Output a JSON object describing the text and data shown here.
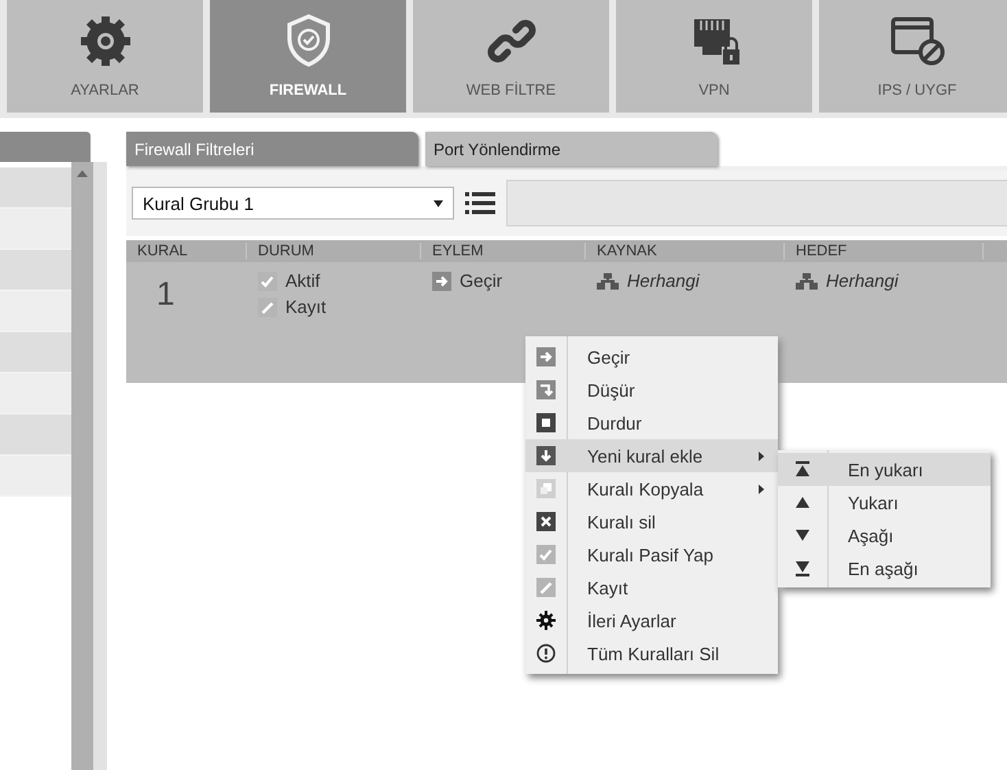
{
  "nav": [
    {
      "label": "AYARLAR",
      "kind": "gear",
      "selected": false
    },
    {
      "label": "FIREWALL",
      "kind": "shield",
      "selected": true
    },
    {
      "label": "WEB FİLTRE",
      "kind": "link",
      "selected": false
    },
    {
      "label": "VPN",
      "kind": "port",
      "selected": false
    },
    {
      "label": "IPS / UYGF",
      "kind": "window",
      "selected": false
    }
  ],
  "tabs": [
    {
      "label": "Firewall Filtreleri",
      "selected": true
    },
    {
      "label": "Port Yönlendirme",
      "selected": false
    }
  ],
  "rule_group": {
    "value": "Kural Grubu 1"
  },
  "table": {
    "columns": [
      "KURAL",
      "DURUM",
      "EYLEM",
      "KAYNAK",
      "HEDEF"
    ],
    "rows": [
      {
        "number": "1",
        "status": [
          {
            "kind": "check",
            "label": "Aktif"
          },
          {
            "kind": "pencil",
            "label": "Kayıt"
          }
        ],
        "action": {
          "kind": "pass",
          "label": "Geçir"
        },
        "source": "Herhangi",
        "target": "Herhangi"
      }
    ]
  },
  "context_menu": {
    "items": [
      {
        "kind": "pass",
        "label": "Geçir",
        "submenu": false,
        "selected": false
      },
      {
        "kind": "drop",
        "label": "Düşür",
        "submenu": false,
        "selected": false
      },
      {
        "kind": "stop",
        "label": "Durdur",
        "submenu": false,
        "selected": false
      },
      {
        "kind": "add",
        "label": "Yeni kural ekle",
        "submenu": true,
        "selected": true
      },
      {
        "kind": "copy",
        "label": "Kuralı Kopyala",
        "submenu": true,
        "selected": false
      },
      {
        "kind": "delete",
        "label": "Kuralı sil",
        "submenu": false,
        "selected": false
      },
      {
        "kind": "check",
        "label": "Kuralı Pasif Yap",
        "submenu": false,
        "selected": false
      },
      {
        "kind": "pencil",
        "label": "Kayıt",
        "submenu": false,
        "selected": false
      },
      {
        "kind": "gear",
        "label": "İleri Ayarlar",
        "submenu": false,
        "selected": false
      },
      {
        "kind": "warning",
        "label": "Tüm Kuralları Sil",
        "submenu": false,
        "selected": false
      }
    ],
    "submenu": [
      {
        "kind": "top",
        "label": "En yukarı",
        "selected": true
      },
      {
        "kind": "up",
        "label": "Yukarı",
        "selected": false
      },
      {
        "kind": "down",
        "label": "Aşağı",
        "selected": false
      },
      {
        "kind": "bottom",
        "label": "En aşağı",
        "selected": false
      }
    ]
  }
}
